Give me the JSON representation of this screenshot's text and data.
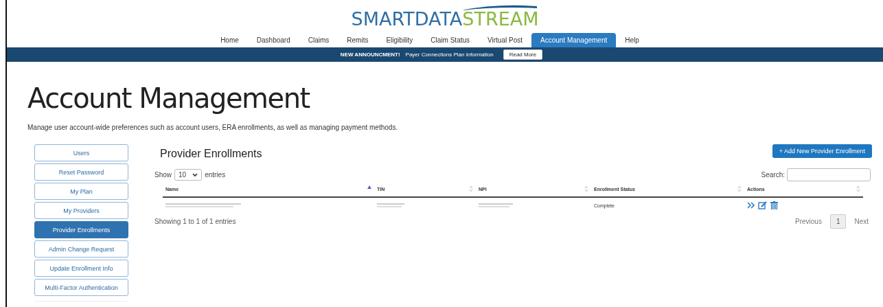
{
  "logo": {
    "part_1": "SMARTDATA",
    "part_2": "STREAM"
  },
  "nav": [
    {
      "label": "Home",
      "selected": false
    },
    {
      "label": "Dashboard",
      "selected": false
    },
    {
      "label": "Claims",
      "selected": false
    },
    {
      "label": "Remits",
      "selected": false
    },
    {
      "label": "Eligibility",
      "selected": false
    },
    {
      "label": "Claim Status",
      "selected": false
    },
    {
      "label": "Virtual Post",
      "selected": false
    },
    {
      "label": "Account Management",
      "selected": true
    },
    {
      "label": "Help",
      "selected": false
    }
  ],
  "announcement": {
    "heading": "NEW ANNOUNCMENT!",
    "text": "Payer Connections Plan Information",
    "button": "Read More"
  },
  "page": {
    "title": "Account Management",
    "description": "Manage user account-wide preferences such as account users, ERA enrollments, as well as managing payment methods."
  },
  "sidebar": {
    "items": [
      {
        "label": "Users",
        "selected": false
      },
      {
        "label": "Reset Password",
        "selected": false
      },
      {
        "label": "My Plan",
        "selected": false
      },
      {
        "label": "My Providers",
        "selected": false
      },
      {
        "label": "Provider Enrollments",
        "selected": true
      },
      {
        "label": "Admin Change Request",
        "selected": false
      },
      {
        "label": "Update Enrollment Info",
        "selected": false
      },
      {
        "label": "Multi-Factor Authentication",
        "selected": false
      }
    ]
  },
  "panel": {
    "title": "Provider Enrollments",
    "add_button": "+ Add New Provider Enrollment",
    "length": {
      "before": "Show",
      "value": "10",
      "after": "entries"
    },
    "search": {
      "label": "Search:"
    },
    "table": {
      "columns": [
        {
          "label": "Name",
          "sorted": true
        },
        {
          "label": "TIN",
          "sorted": false
        },
        {
          "label": "NPI",
          "sorted": false
        },
        {
          "label": "Enrollment Status",
          "sorted": false
        },
        {
          "label": "Actions",
          "sorted": false
        }
      ],
      "rows": [
        {
          "status": "Complete"
        }
      ]
    },
    "info": "Showing 1 to 1 of 1 entries",
    "pagination": {
      "previous": "Previous",
      "pages": [
        {
          "label": "1",
          "selected": true
        }
      ],
      "next": "Next"
    }
  }
}
